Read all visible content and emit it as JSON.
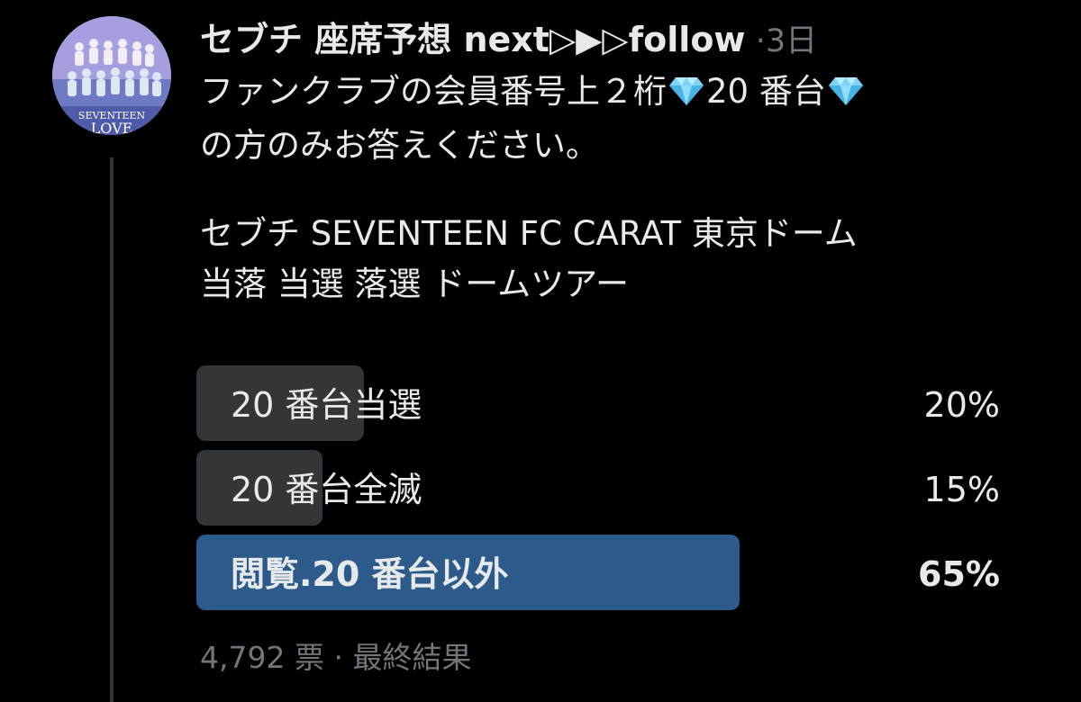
{
  "tweet": {
    "display_name": "セブチ 座席予想 next▷▶▷follow",
    "separator": "·",
    "timestamp": "3日",
    "avatar_icon": "group-photo-avatar",
    "text_lines": [
      "ファンクラブの会員番号上２桁",
      "20 番台",
      "の方のみお答えください。"
    ],
    "gem_icon": "gem-stone-emoji",
    "text_lines_2": [
      "セブチ SEVENTEEN FC CARAT 東京ドーム",
      "当落 当選 落選 ドームツアー"
    ]
  },
  "poll": {
    "options": [
      {
        "label": "20 番台当選",
        "percent_label": "20%",
        "percent": 20,
        "winner": false
      },
      {
        "label": "20 番台全滅",
        "percent_label": "15%",
        "percent": 15,
        "winner": false
      },
      {
        "label": "閲覧.20 番台以外",
        "percent_label": "65%",
        "percent": 65,
        "winner": true
      }
    ],
    "votes": "4,792 票",
    "footer_separator": "·",
    "status": "最終結果"
  },
  "colors": {
    "background": "#000000",
    "text": "#e7e9ea",
    "muted": "#71767b",
    "bar": "#333639",
    "winner_bar": "#2c5a8a"
  }
}
